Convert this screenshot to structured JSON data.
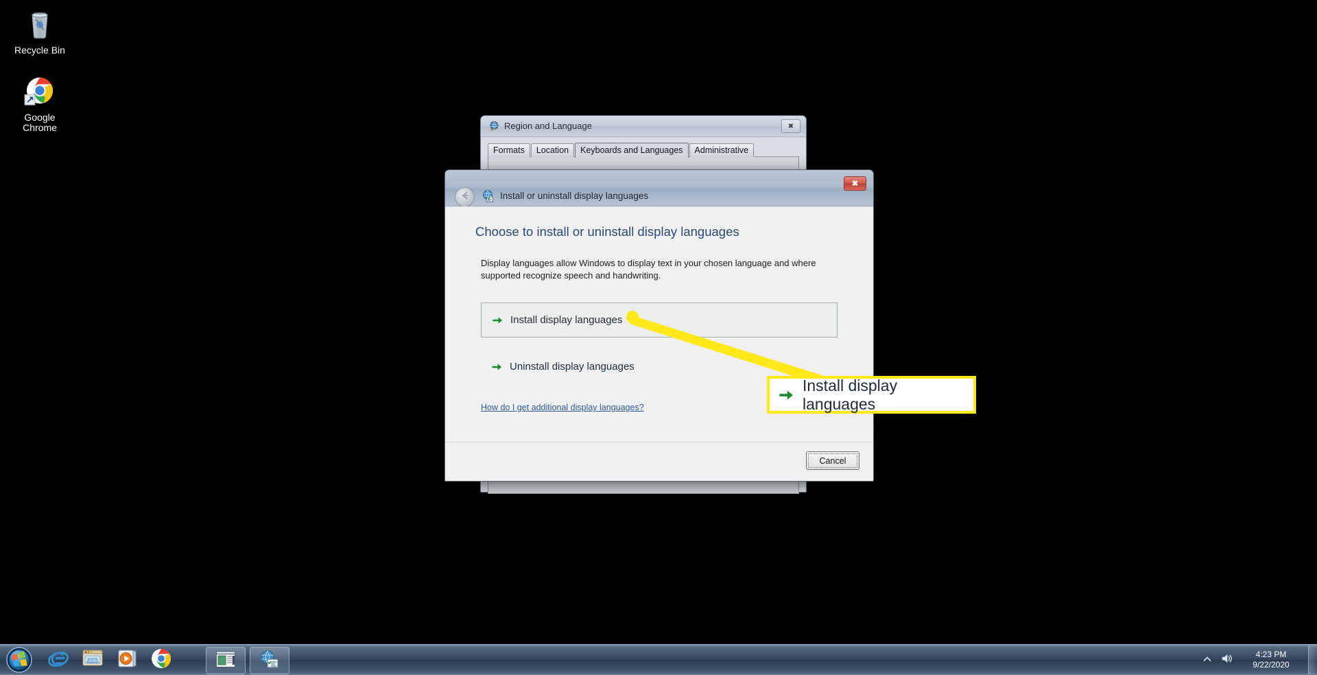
{
  "desktop": {
    "icons": [
      {
        "name": "recycle-bin",
        "label": "Recycle Bin"
      },
      {
        "name": "google-chrome",
        "label": "Google\nChrome"
      }
    ]
  },
  "region_window": {
    "title": "Region and Language",
    "icon": "globe-icon",
    "close_label": "✖",
    "tabs": [
      {
        "label": "Formats",
        "active": false
      },
      {
        "label": "Location",
        "active": false
      },
      {
        "label": "Keyboards and Languages",
        "active": true
      },
      {
        "label": "Administrative",
        "active": false
      }
    ]
  },
  "dialog": {
    "header_title": "Install or uninstall display languages",
    "header_icon": "language-globe-icon",
    "back_icon": "back-arrow-icon",
    "close_label": "✖",
    "heading": "Choose to install or uninstall display languages",
    "description": "Display languages allow Windows to display text in your chosen language and where supported recognize speech and handwriting.",
    "tasks": [
      {
        "name": "install-display-languages",
        "label": "Install display languages",
        "icon": "green-arrow-icon",
        "boxed": true
      },
      {
        "name": "uninstall-display-languages",
        "label": "Uninstall display languages",
        "icon": "green-arrow-icon",
        "boxed": false
      }
    ],
    "help_link": "How do I get additional display languages?",
    "cancel_label": "Cancel"
  },
  "annotation": {
    "callout_text": "Install display languages",
    "callout_icon": "green-arrow-icon",
    "highlight_color": "#ffe817"
  },
  "taskbar": {
    "start_label": "Start",
    "pinned": [
      {
        "name": "internet-explorer-icon"
      },
      {
        "name": "windows-explorer-icon"
      },
      {
        "name": "windows-media-player-icon"
      },
      {
        "name": "google-chrome-icon"
      }
    ],
    "running": [
      {
        "name": "window-button-explorer"
      },
      {
        "name": "window-button-region-language"
      }
    ],
    "tray": {
      "show_hidden_icon": "chevron-up-icon",
      "volume_icon": "speaker-icon",
      "time": "4:23 PM",
      "date": "9/22/2020"
    }
  }
}
